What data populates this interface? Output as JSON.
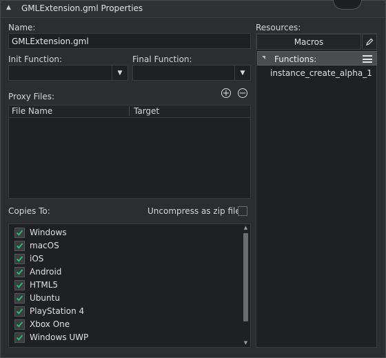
{
  "window": {
    "title": "GMLExtension.gml Properties"
  },
  "name": {
    "label": "Name:",
    "value": "GMLExtension.gml"
  },
  "init_function": {
    "label": "Init Function:",
    "value": ""
  },
  "final_function": {
    "label": "Final Function:",
    "value": ""
  },
  "proxy_files": {
    "label": "Proxy Files:",
    "columns": [
      "File Name",
      "Target"
    ]
  },
  "copies_to": {
    "label": "Copies To:",
    "uncompress_label": "Uncompress as zip file",
    "uncompress_checked": false,
    "platforms": [
      {
        "label": "Windows",
        "checked": true
      },
      {
        "label": "macOS",
        "checked": true
      },
      {
        "label": "iOS",
        "checked": true
      },
      {
        "label": "Android",
        "checked": true
      },
      {
        "label": "HTML5",
        "checked": true
      },
      {
        "label": "Ubuntu",
        "checked": true
      },
      {
        "label": "PlayStation 4",
        "checked": true
      },
      {
        "label": "Xbox One",
        "checked": true
      },
      {
        "label": "Windows UWP",
        "checked": true
      }
    ]
  },
  "resources": {
    "label": "Resources:",
    "macros_label": "Macros",
    "functions_label": "Functions:",
    "functions": [
      "instance_create_alpha_1"
    ]
  },
  "colors": {
    "check": "#2bb673",
    "background": "#2b2d2e",
    "field": "#1f2021"
  }
}
